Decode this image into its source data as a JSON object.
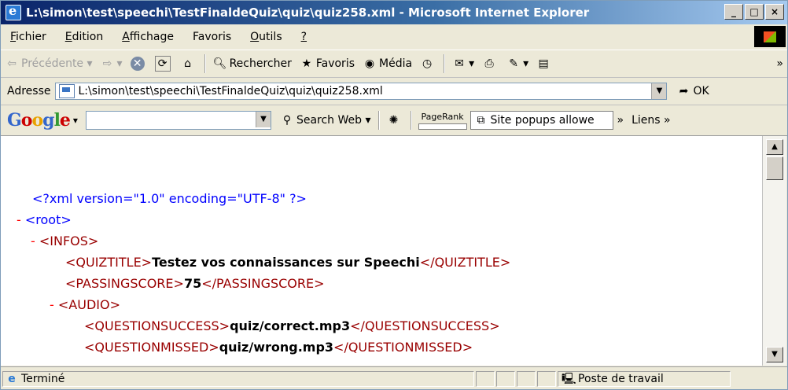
{
  "window": {
    "title": "L:\\simon\\test\\speechi\\TestFinaldeQuiz\\quiz\\quiz258.xml - Microsoft Internet Explorer",
    "min": "_",
    "max": "□",
    "close": "×"
  },
  "menu": {
    "items": [
      {
        "first": "F",
        "rest": "ichier"
      },
      {
        "first": "E",
        "rest": "dition"
      },
      {
        "first": "A",
        "rest": "ffichage"
      },
      {
        "first": "Fa",
        "rest": "voris",
        "u": "v"
      },
      {
        "first": "O",
        "rest": "utils"
      },
      {
        "first": "?",
        "rest": ""
      }
    ]
  },
  "toolbar": {
    "back": "Précédente",
    "search": "Rechercher",
    "favorites": "Favoris",
    "media": "Média"
  },
  "address": {
    "label": "Adresse",
    "value": "L:\\simon\\test\\speechi\\TestFinaldeQuiz\\quiz\\quiz258.xml",
    "go": "OK"
  },
  "google": {
    "search_web": "Search Web",
    "pagerank": "PageRank",
    "popups": "Site popups allowe",
    "links": "Liens"
  },
  "xml": {
    "decl": "<?xml version=\"1.0\" encoding=\"UTF-8\" ?>",
    "root_open": "<root>",
    "infos_open": "<INFOS>",
    "quiztitle_open": "<QUIZTITLE>",
    "quiztitle_val": "Testez vos connaissances sur Speechi",
    "quiztitle_close": "</QUIZTITLE>",
    "passingscore_open": "<PASSINGSCORE>",
    "passingscore_val": "75",
    "passingscore_close": "</PASSINGSCORE>",
    "audio_open": "<AUDIO>",
    "qsuccess_open": "<QUESTIONSUCCESS>",
    "qsuccess_val": "quiz/correct.mp3",
    "qsuccess_close": "</QUESTIONSUCCESS>",
    "qmissed_open": "<QUESTIONMISSED>",
    "qmissed_val": "quiz/wrong.mp3",
    "qmissed_close": "</QUESTIONMISSED>",
    "minus": "-"
  },
  "status": {
    "text": "Terminé",
    "zone": "Poste de travail"
  }
}
